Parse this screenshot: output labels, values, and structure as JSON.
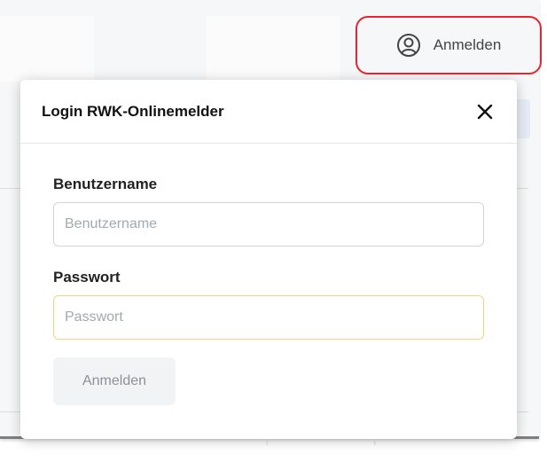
{
  "header": {
    "login_label": "Anmelden",
    "user_icon": "user-circle-icon",
    "highlight_color": "#e3262f"
  },
  "login_popover": {
    "title": "Login RWK-Onlinemelder",
    "close_icon": "close-icon",
    "username": {
      "label": "Benutzername",
      "placeholder": "Benutzername",
      "value": ""
    },
    "password": {
      "label": "Passwort",
      "placeholder": "Passwort",
      "value": ""
    },
    "submit_label": "Anmelden",
    "focus_border_color": "#f2d579"
  }
}
